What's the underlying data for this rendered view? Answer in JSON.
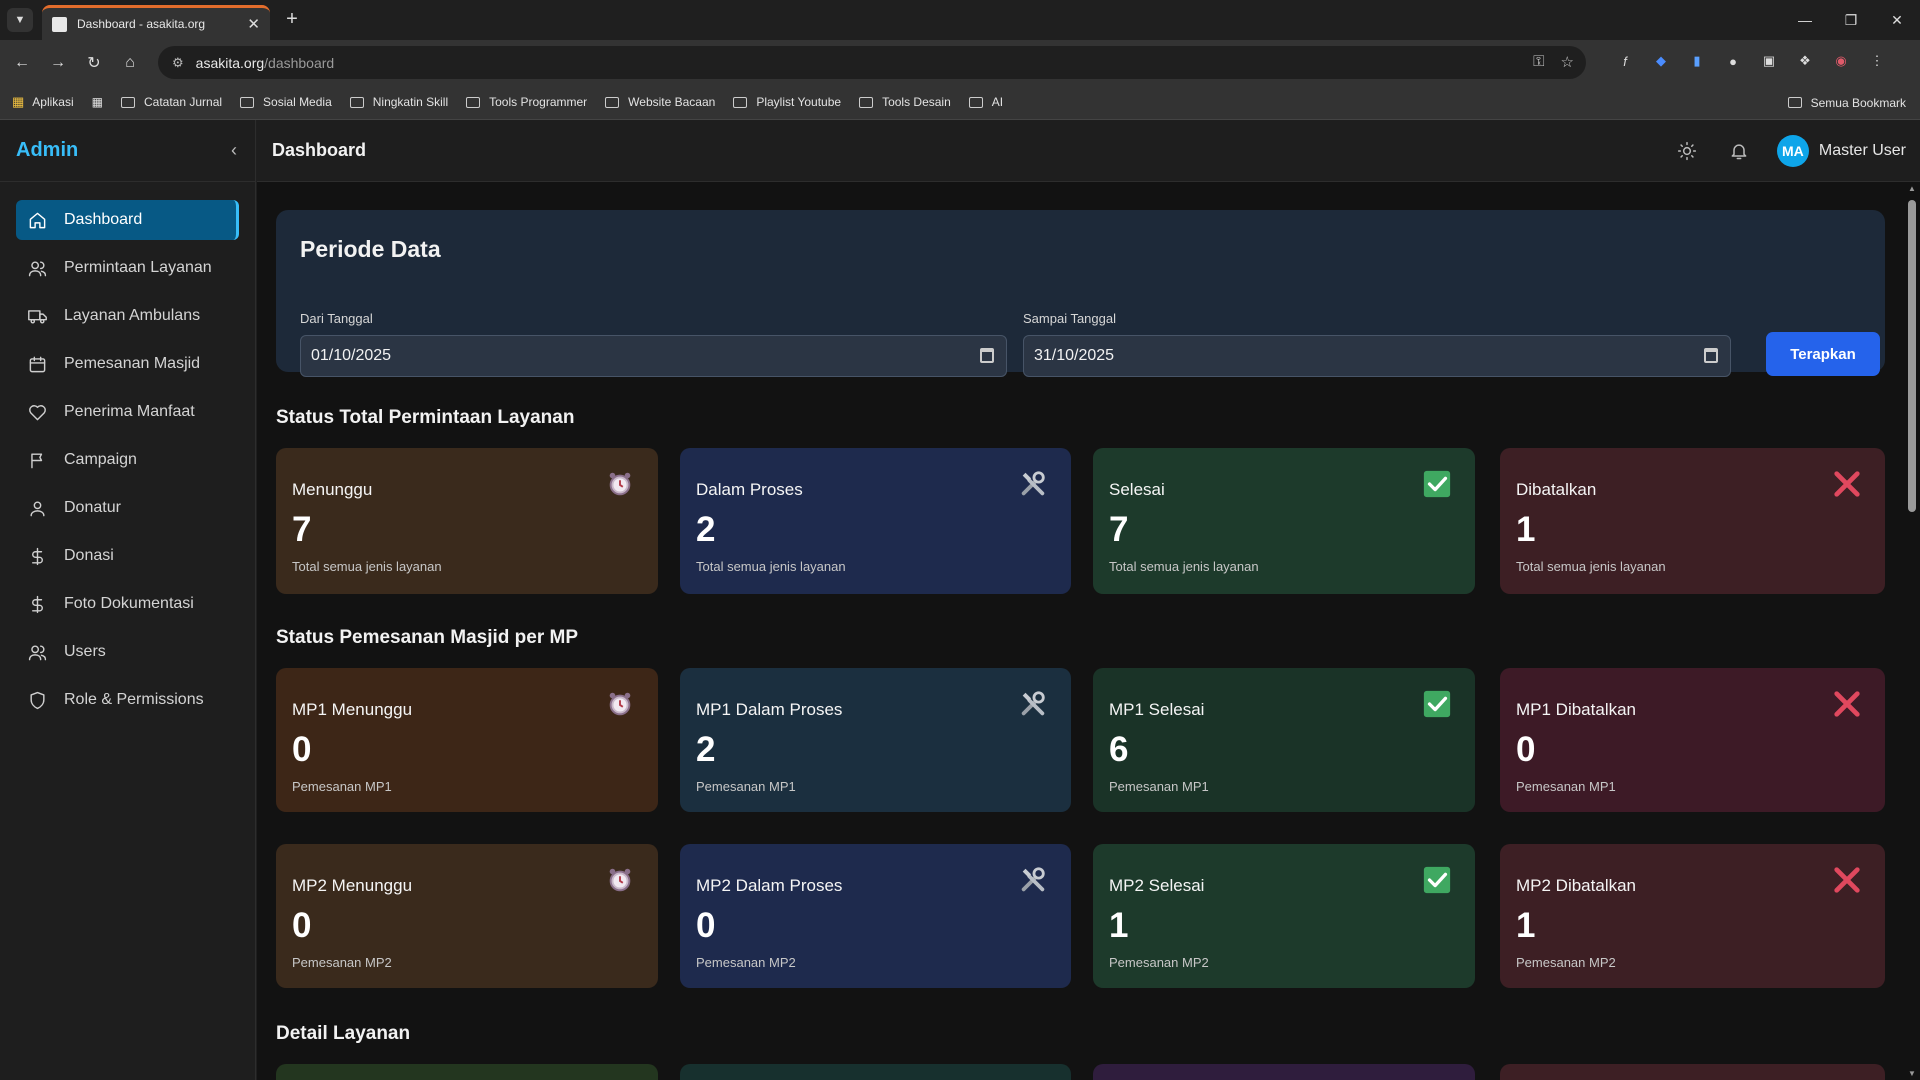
{
  "browser": {
    "tab_title": "Dashboard - asakita.org",
    "url_host": "asakita.org",
    "url_path": "/dashboard",
    "bookmarks": [
      "Aplikasi",
      "Catatan Jurnal",
      "Sosial Media",
      "Ningkatin Skill",
      "Tools Programmer",
      "Website Bacaan",
      "Playlist Youtube",
      "Tools Desain",
      "AI"
    ],
    "all_bookmarks": "Semua Bookmark"
  },
  "sidebar": {
    "brand": "Admin",
    "items": [
      {
        "label": "Dashboard",
        "icon": "home-icon"
      },
      {
        "label": "Permintaan Layanan",
        "icon": "users-icon"
      },
      {
        "label": "Layanan Ambulans",
        "icon": "truck-icon"
      },
      {
        "label": "Pemesanan Masjid",
        "icon": "calendar-icon"
      },
      {
        "label": "Penerima Manfaat",
        "icon": "heart-icon"
      },
      {
        "label": "Campaign",
        "icon": "flag-icon"
      },
      {
        "label": "Donatur",
        "icon": "user-icon"
      },
      {
        "label": "Donasi",
        "icon": "dollar-icon"
      },
      {
        "label": "Foto Dokumentasi",
        "icon": "dollar-icon"
      },
      {
        "label": "Users",
        "icon": "users-icon"
      },
      {
        "label": "Role & Permissions",
        "icon": "shield-icon"
      }
    ]
  },
  "header": {
    "title": "Dashboard",
    "avatar_initials": "MA",
    "user_name": "Master User"
  },
  "period": {
    "title": "Periode Data",
    "from_label": "Dari Tanggal",
    "from_value": "01/10/2025",
    "to_label": "Sampai Tanggal",
    "to_value": "31/10/2025",
    "apply_label": "Terapkan"
  },
  "sections": {
    "status_total": "Status Total Permintaan Layanan",
    "status_mp": "Status Pemesanan Masjid per MP",
    "detail": "Detail Layanan"
  },
  "status_total": [
    {
      "label": "Menunggu",
      "value": "7",
      "sub": "Total semua jenis layanan",
      "icon": "alarm-clock-icon",
      "color": "#3a2a1c"
    },
    {
      "label": "Dalam Proses",
      "value": "2",
      "sub": "Total semua jenis layanan",
      "icon": "tools-icon",
      "color": "#1e2a4d"
    },
    {
      "label": "Selesai",
      "value": "7",
      "sub": "Total semua jenis layanan",
      "icon": "check-box-icon",
      "color": "#1d3a2b"
    },
    {
      "label": "Dibatalkan",
      "value": "1",
      "sub": "Total semua jenis layanan",
      "icon": "cross-icon",
      "color": "#3d1f24"
    }
  ],
  "mp1": [
    {
      "label": "MP1 Menunggu",
      "value": "0",
      "sub": "Pemesanan MP1",
      "icon": "alarm-clock-icon",
      "color": "#3d2617"
    },
    {
      "label": "MP1 Dalam Proses",
      "value": "2",
      "sub": "Pemesanan MP1",
      "icon": "tools-icon",
      "color": "#1b2f3f"
    },
    {
      "label": "MP1 Selesai",
      "value": "6",
      "sub": "Pemesanan MP1",
      "icon": "check-box-icon",
      "color": "#1a3327"
    },
    {
      "label": "MP1 Dibatalkan",
      "value": "0",
      "sub": "Pemesanan MP1",
      "icon": "cross-icon",
      "color": "#3d1a26"
    }
  ],
  "mp2": [
    {
      "label": "MP2 Menunggu",
      "value": "0",
      "sub": "Pemesanan MP2",
      "icon": "alarm-clock-icon",
      "color": "#3a2a1c"
    },
    {
      "label": "MP2 Dalam Proses",
      "value": "0",
      "sub": "Pemesanan MP2",
      "icon": "tools-icon",
      "color": "#1e2a4d"
    },
    {
      "label": "MP2 Selesai",
      "value": "1",
      "sub": "Pemesanan MP2",
      "icon": "check-box-icon",
      "color": "#1d3a2b"
    },
    {
      "label": "MP2 Dibatalkan",
      "value": "1",
      "sub": "Pemesanan MP2",
      "icon": "cross-icon",
      "color": "#3d1f24"
    }
  ],
  "detail_colors": [
    "#23361f",
    "#17302e",
    "#2f1d3d",
    "#3d1f24"
  ]
}
